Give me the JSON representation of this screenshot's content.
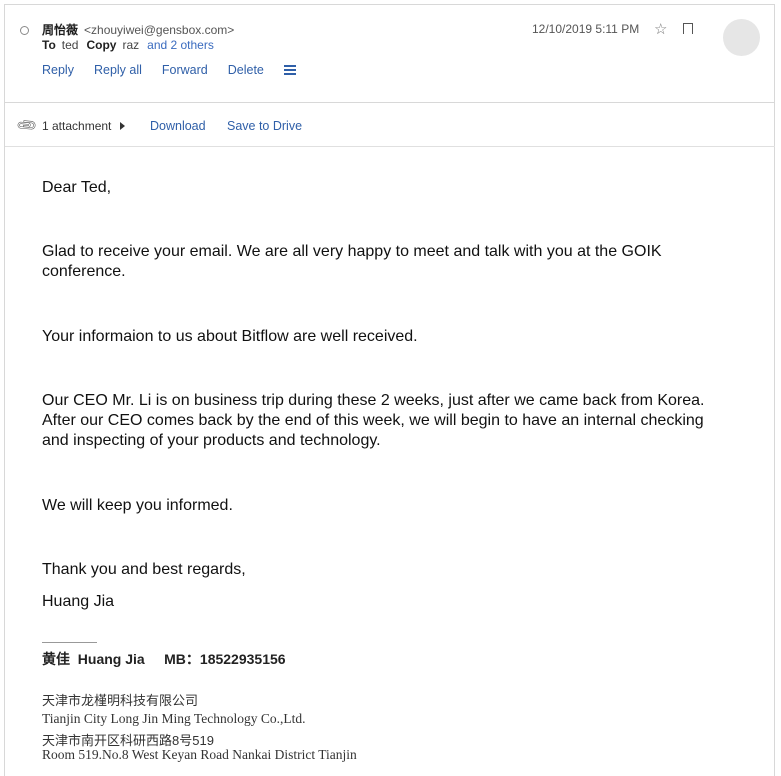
{
  "header": {
    "sender_name": "周怡薇",
    "sender_email": "<zhouyiwei@gensbox.com>",
    "to_label": "To",
    "to_value": "ted",
    "copy_label": "Copy",
    "copy_value": "raz",
    "others": "and 2 others",
    "date": "12/10/2019 5:11 PM",
    "actions": [
      "Reply",
      "Reply all",
      "Forward",
      "Delete"
    ]
  },
  "attachment": {
    "count": "1 attachment",
    "download": "Download",
    "save": "Save to Drive"
  },
  "body": {
    "greeting": "Dear Ted,",
    "p1": "Glad to receive your email. We are all very happy to meet and talk with you at the GOIK conference.",
    "p2": "Your informaion to us about Bitflow are well received.",
    "p3": "Our CEO Mr. Li is on business trip during these 2 weeks, just after we came back from Korea. After our CEO comes back by the end of this week, we will begin to have an internal checking and inspecting of your products and technology.",
    "p4": "We will keep you informed.",
    "closing": "Thank you and best regards,",
    "signoff": "Huang Jia"
  },
  "signature": {
    "name_line": "黄佳  Huang Jia     MB：18522935156",
    "company_cn": "天津市龙槿明科技有限公司",
    "company_en": "Tianjin City Long Jin Ming Technology Co.,Ltd.",
    "address_cn": "天津市南开区科研西路8号519",
    "address_en": "Room 519.No.8 West Keyan Road Nankai District Tianjin"
  },
  "icons": [
    "status-dot-icon",
    "star-icon",
    "bookmark-icon",
    "menu-icon",
    "paperclip-icon",
    "chevron-right-icon"
  ]
}
